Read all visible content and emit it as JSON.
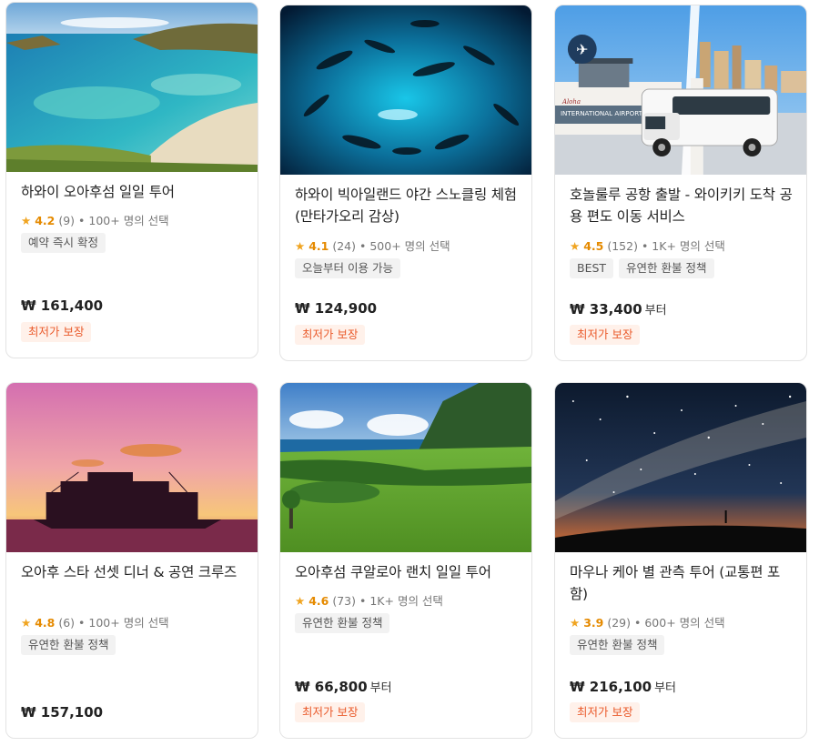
{
  "cards": [
    {
      "title": "하와이 오아후섬 일일 투어",
      "rating": "4.2",
      "reviews": "(9)",
      "popularity": "• 100+ 명의 선택",
      "tags": [
        "예약 즉시 확정"
      ],
      "price": "₩ 161,400",
      "price_suffix": "",
      "badge": "최저가 보장"
    },
    {
      "title": "하와이 빅아일랜드 야간 스노클링 체험 (만타가오리 감상)",
      "rating": "4.1",
      "reviews": "(24)",
      "popularity": "• 500+ 명의 선택",
      "tags": [
        "오늘부터 이용 가능"
      ],
      "price": "₩ 124,900",
      "price_suffix": "",
      "badge": "최저가 보장"
    },
    {
      "title": "호놀룰루 공항 출발 - 와이키키 도착 공용 편도 이동 서비스",
      "rating": "4.5",
      "reviews": "(152)",
      "popularity": "• 1K+ 명의 선택",
      "tags": [
        "BEST",
        "유연한 환불 정책"
      ],
      "price": "₩ 33,400",
      "price_suffix": "부터",
      "badge": "최저가 보장",
      "image_sign": "INTERNATIONAL AIRPORT"
    },
    {
      "title": "오아후 스타 선셋 디너 & 공연 크루즈",
      "rating": "4.8",
      "reviews": "(6)",
      "popularity": "• 100+ 명의 선택",
      "tags": [
        "유연한 환불 정책"
      ],
      "price": "₩ 157,100",
      "price_suffix": "",
      "badge": ""
    },
    {
      "title": "오아후섬 쿠알로아 랜치 일일 투어",
      "rating": "4.6",
      "reviews": "(73)",
      "popularity": "• 1K+ 명의 선택",
      "tags": [
        "유연한 환불 정책"
      ],
      "price": "₩ 66,800",
      "price_suffix": "부터",
      "badge": "최저가 보장"
    },
    {
      "title": "마우나 케아 별 관측 투어 (교통편 포함)",
      "rating": "3.9",
      "reviews": "(29)",
      "popularity": "• 600+ 명의 선택",
      "tags": [
        "유연한 환불 정책"
      ],
      "price": "₩ 216,100",
      "price_suffix": "부터",
      "badge": "최저가 보장"
    }
  ],
  "colors": {
    "rating": "#e58a00",
    "star": "#f0a420",
    "badge_text": "#ea5a2b",
    "badge_bg": "#fff1ea"
  },
  "icons": {
    "star": "star-icon",
    "airport": "airplane-icon"
  }
}
